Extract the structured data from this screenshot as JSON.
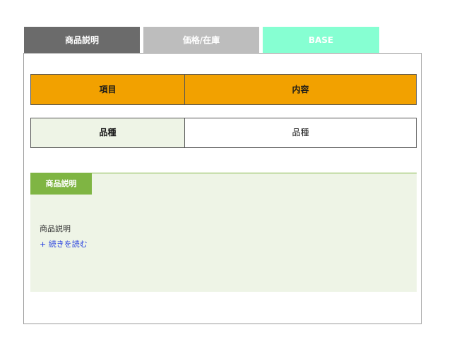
{
  "tabs": [
    {
      "label": "商品説明"
    },
    {
      "label": "価格/在庫"
    },
    {
      "label": "BASE"
    }
  ],
  "table": {
    "headers": [
      "項目",
      "内容"
    ],
    "rows": [
      {
        "item": "品種",
        "content": "品種"
      }
    ]
  },
  "description": {
    "label": "商品説明",
    "text": "商品説明",
    "read_more": "+ 続きを読む"
  },
  "colors": {
    "tab_active": "#6b6b6b",
    "tab_inactive": "#bdbdbd",
    "tab_base": "#86ffd2",
    "header_bg": "#f2a100",
    "item_bg": "#eef4e6",
    "accent_green": "#7fb543",
    "link": "#2b44e0"
  }
}
